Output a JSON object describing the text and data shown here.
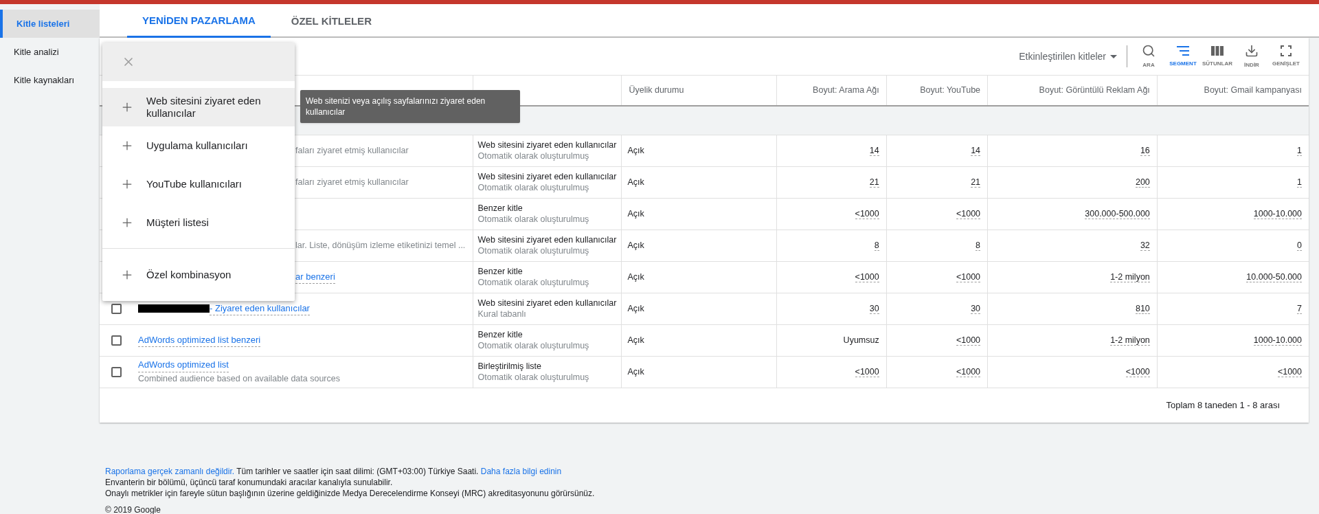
{
  "sidebar": {
    "items": [
      {
        "label": "Kitle listeleri",
        "selected": true
      },
      {
        "label": "Kitle analizi",
        "selected": false
      },
      {
        "label": "Kitle kaynakları",
        "selected": false
      }
    ]
  },
  "tabs": [
    {
      "label": "YENİDEN PAZARLAMA",
      "selected": true
    },
    {
      "label": "ÖZEL KİTLELER",
      "selected": false
    }
  ],
  "toolbar": {
    "filter": "Etkinleştirilen kitleler",
    "actions": [
      {
        "kind": "search",
        "label": "ARA",
        "selected": false
      },
      {
        "kind": "segment",
        "label": "SEGMENT",
        "selected": true
      },
      {
        "kind": "columns",
        "label": "SÜTUNLAR",
        "selected": false
      },
      {
        "kind": "download",
        "label": "İNDİR",
        "selected": false
      },
      {
        "kind": "expand",
        "label": "GENİŞLET",
        "selected": false
      }
    ]
  },
  "table": {
    "columns": [
      "Üyelik durumu",
      "Boyut: Arama Ağı",
      "Boyut: YouTube",
      "Boyut: Görüntülü Reklam Ağı",
      "Boyut: Gmail kampanyası"
    ],
    "rows": [
      {
        "covered": true,
        "redacted": false,
        "description": "faları ziyaret etmiş kullanıcılar",
        "type": "Web sitesini ziyaret eden kullanıcılar",
        "origin": "Otomatik olarak oluşturulmuş",
        "status": "Açık",
        "sizes": [
          "14",
          "14",
          "16",
          "1"
        ]
      },
      {
        "covered": true,
        "redacted": false,
        "description": "faları ziyaret etmiş kullanıcılar",
        "type": "Web sitesini ziyaret eden kullanıcılar",
        "origin": "Otomatik olarak oluşturulmuş",
        "status": "Açık",
        "sizes": [
          "21",
          "21",
          "200",
          "1"
        ]
      },
      {
        "type": "Benzer kitle",
        "origin": "Otomatik olarak oluşturulmuş",
        "status": "Açık",
        "sizes": [
          "<1000",
          "<1000",
          "300.000-500.000",
          "1000-10.000"
        ]
      },
      {
        "covered": true,
        "redacted": false,
        "description": "lar. Liste, dönüşüm izleme etiketinizi temel ...",
        "type": "Web sitesini ziyaret eden kullanıcılar",
        "origin": "Otomatik olarak oluşturulmuş",
        "status": "Açık",
        "sizes": [
          "8",
          "8",
          "32",
          "0"
        ]
      },
      {
        "covered": true,
        "redacted": false,
        "name": "ar benzeri",
        "type": "Benzer kitle",
        "origin": "Otomatik olarak oluşturulmuş",
        "status": "Açık",
        "sizes": [
          "<1000",
          "<1000",
          "1-2 milyon",
          "10.000-50.000"
        ]
      },
      {
        "covered": false,
        "checked": false,
        "redacted": true,
        "name": "- Ziyaret eden kullanıcılar",
        "type": "Web sitesini ziyaret eden kullanıcılar",
        "origin": "Kural tabanlı",
        "status": "Açık",
        "sizes": [
          "30",
          "30",
          "810",
          "7"
        ]
      },
      {
        "covered": false,
        "checked": false,
        "redacted": false,
        "name": "AdWords optimized list benzeri",
        "type": "Benzer kitle",
        "origin": "Otomatik olarak oluşturulmuş",
        "status": "Açık",
        "sizes": [
          "Uyumsuz",
          "<1000",
          "1-2 milyon",
          "1000-10.000"
        ]
      },
      {
        "covered": false,
        "checked": false,
        "redacted": false,
        "name": "AdWords optimized list",
        "description": "Combined audience based on available data sources",
        "type": "Birleştirilmiş liste",
        "origin": "Otomatik olarak oluşturulmuş",
        "status": "Açık",
        "sizes": [
          "<1000",
          "<1000",
          "<1000",
          "<1000"
        ]
      }
    ],
    "pagination": "Toplam 8 taneden 1 - 8 arası"
  },
  "add_menu": {
    "items": [
      {
        "label": "Web sitesini ziyaret eden kullanıcılar",
        "highlighted": true
      },
      {
        "label": "Uygulama kullanıcıları",
        "highlighted": false
      },
      {
        "label": "YouTube kullanıcıları",
        "highlighted": false
      },
      {
        "label": "Müşteri listesi",
        "highlighted": false
      }
    ],
    "extra_items": [
      {
        "label": "Özel kombinasyon",
        "highlighted": false
      }
    ]
  },
  "tooltip": "Web sitenizi veya açılış sayfalarınızı ziyaret eden kullanıcılar",
  "footer": {
    "notice": [
      {
        "kind": "link",
        "text": "Raporlama gerçek zamanlı değildir."
      },
      {
        "kind": "text",
        "text": " Tüm tarihler ve saatler için saat dilimi: (GMT+03:00) Türkiye Saati. "
      },
      {
        "kind": "link",
        "text": "Daha fazla bilgi edinin"
      }
    ],
    "lines": [
      "Envanterin bir bölümü, üçüncü taraf konumundaki aracılar kanalıyla sunulabilir.",
      "Onaylı metrikler için fareyle sütun başlığının üzerine geldiğinizde Medya Derecelendirme Konseyi (MRC) akreditasyonunu görürsünüz."
    ],
    "copyright": "© 2019 Google"
  }
}
